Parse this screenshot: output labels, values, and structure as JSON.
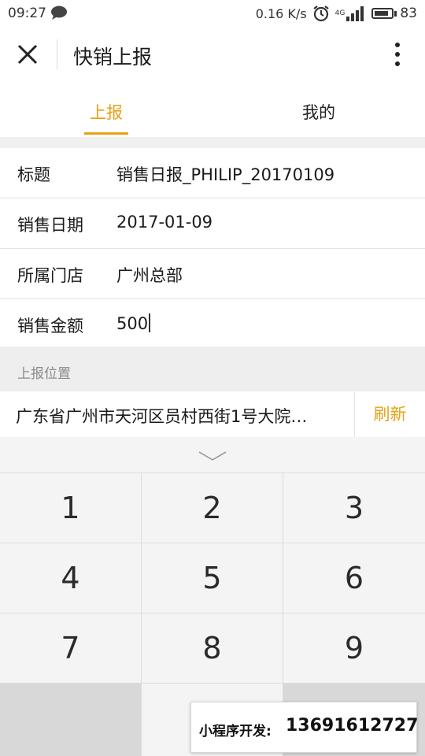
{
  "status_bar": {
    "time": "09:27",
    "net_speed": "0.16 K/s",
    "network": "4G",
    "battery": "83",
    "battery_level": 0.83
  },
  "header": {
    "title": "快销上报"
  },
  "tabs": [
    {
      "label": "上报",
      "active": true
    },
    {
      "label": "我的",
      "active": false
    }
  ],
  "form": {
    "rows": [
      {
        "label": "标题",
        "value": "销售日报_PHILIP_20170109"
      },
      {
        "label": "销售日期",
        "value": "2017-01-09"
      },
      {
        "label": "所属门店",
        "value": "广州总部"
      },
      {
        "label": "销售金额",
        "value": "500"
      }
    ]
  },
  "location": {
    "section_title": "上报位置",
    "address": "广东省广州市天河区员村西街1号大院…",
    "refresh_label": "刷新"
  },
  "keypad": {
    "keys": [
      "1",
      "2",
      "3",
      "4",
      "5",
      "6",
      "7",
      "8",
      "9"
    ]
  },
  "watermark": {
    "label": "小程序开发:",
    "phone": "13691612727"
  },
  "colors": {
    "accent": "#e6a117",
    "background": "#ffffff",
    "divider": "#e3e3e3",
    "keypad_bg": "#f4f4f4"
  }
}
